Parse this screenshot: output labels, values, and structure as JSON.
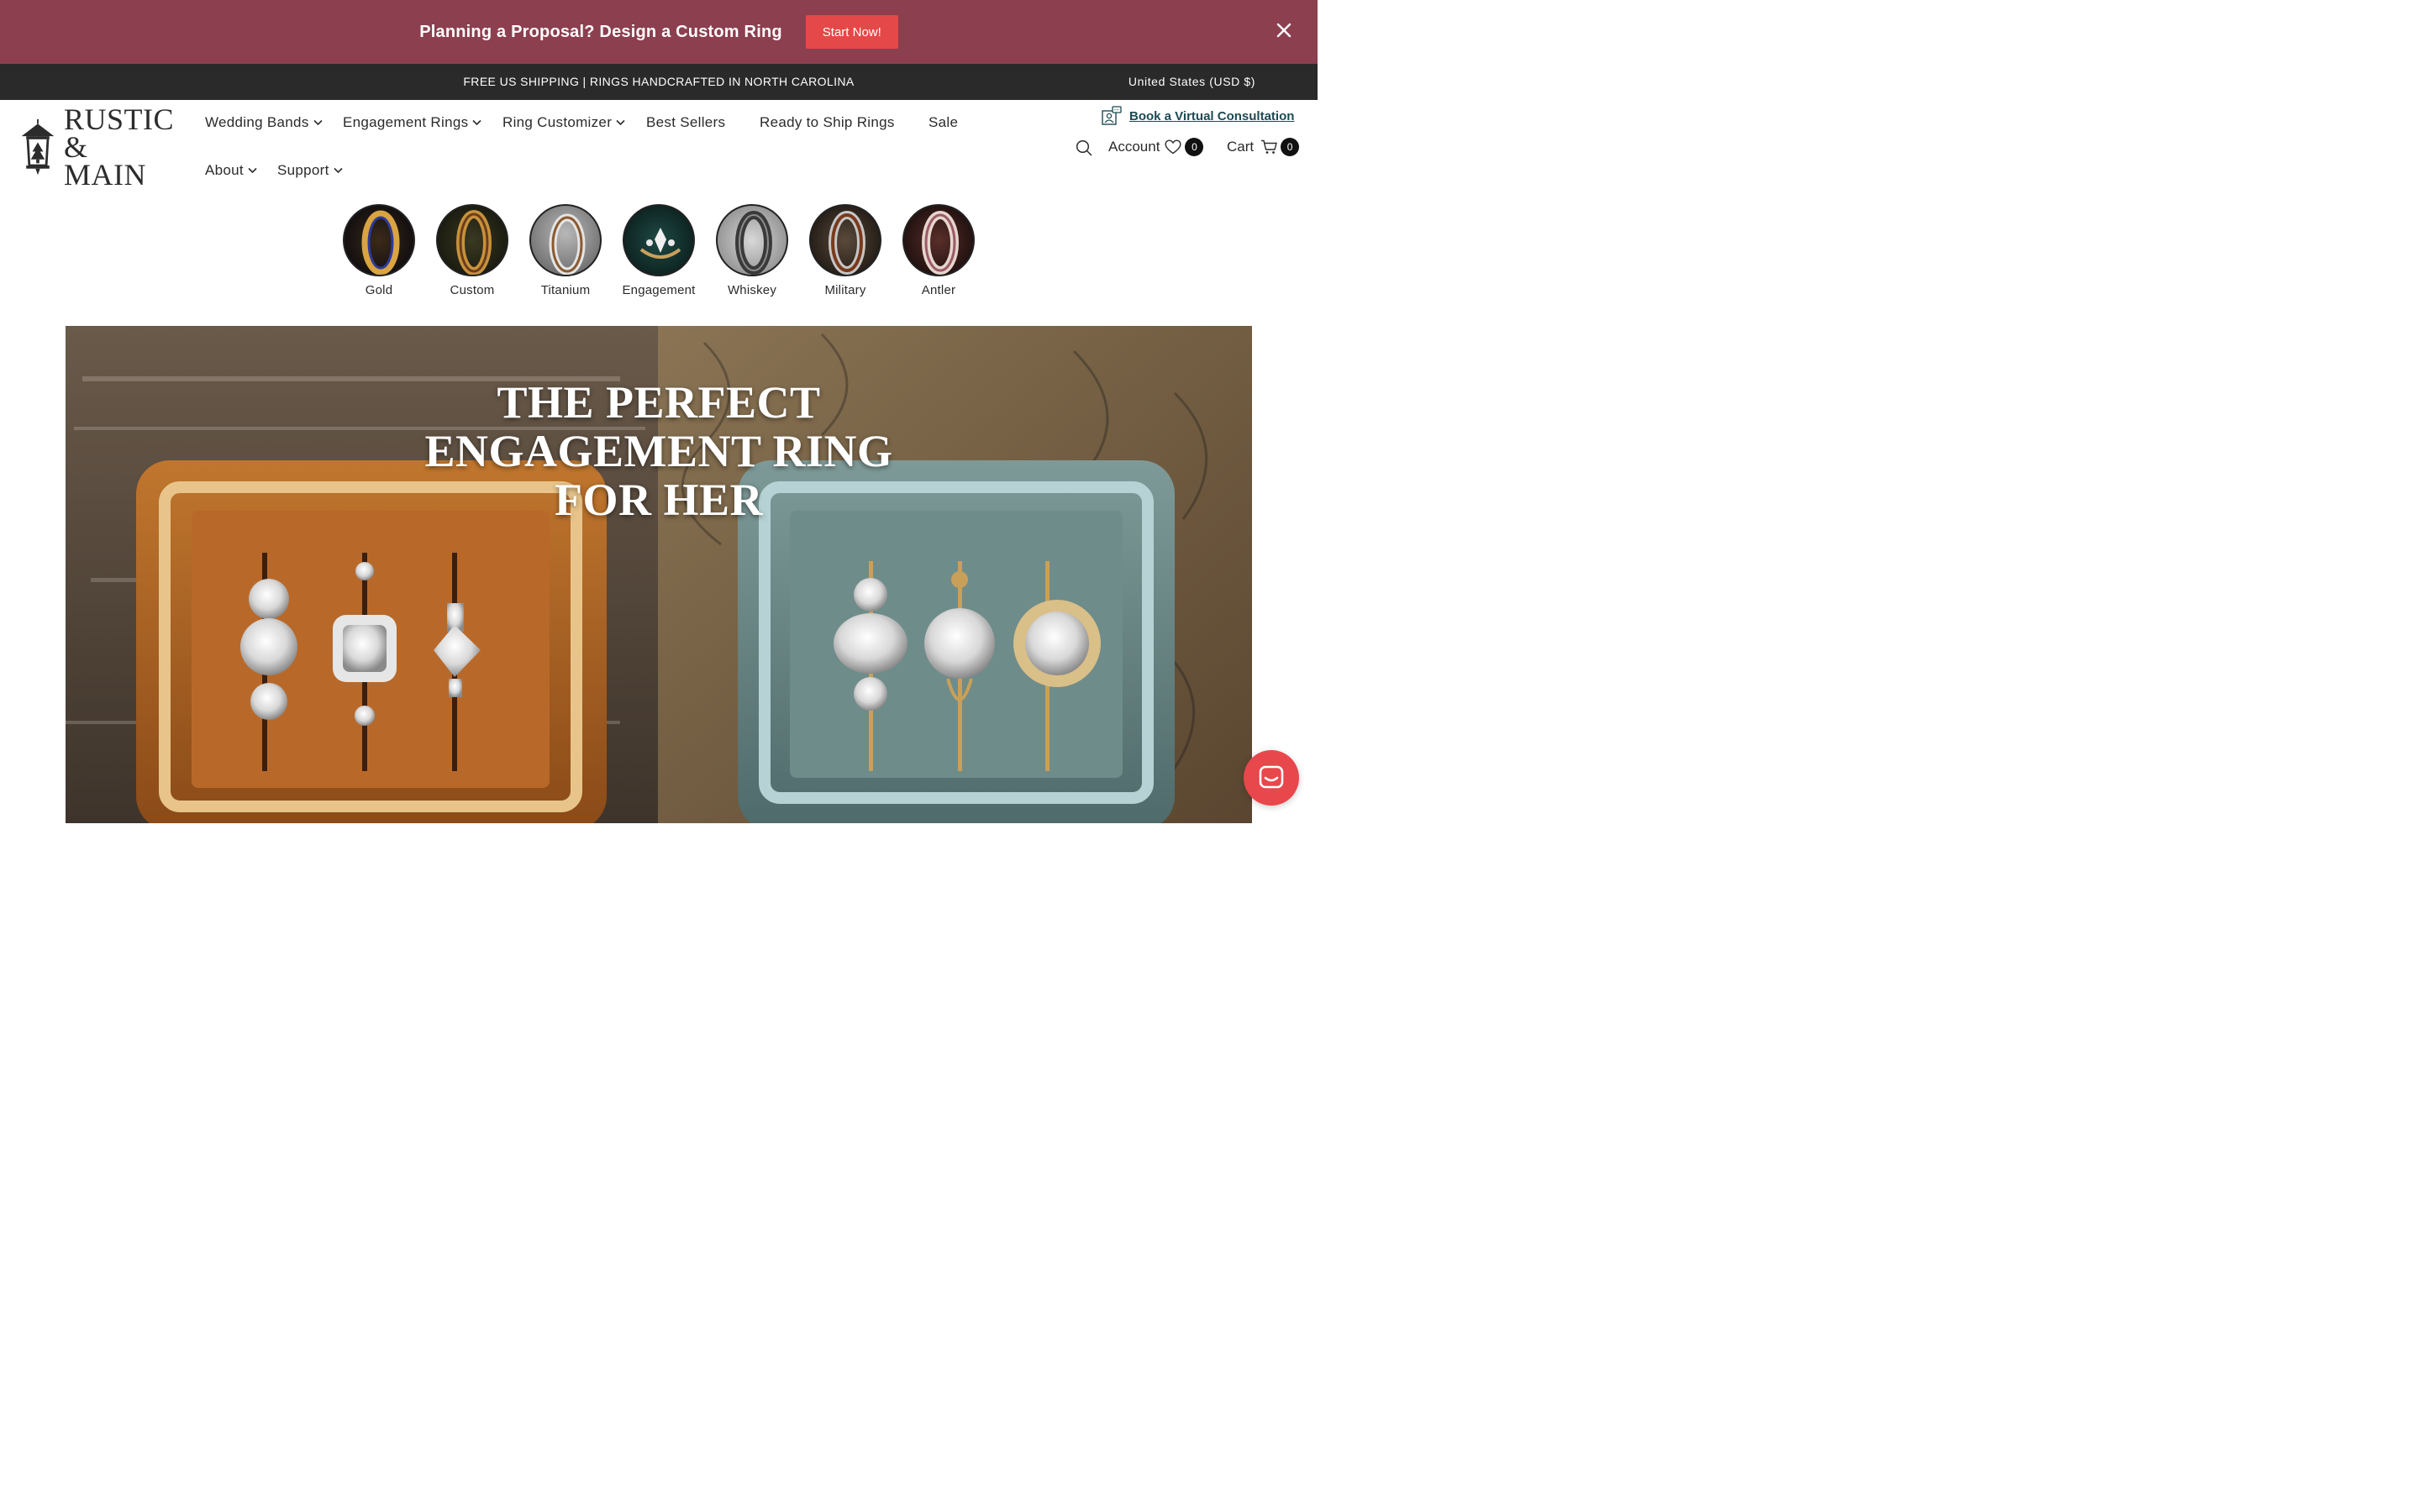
{
  "promo": {
    "text": "Planning a Proposal? Design a Custom Ring",
    "cta": "Start Now!",
    "bg_color": "#8c3f4f",
    "cta_color": "#e54848"
  },
  "shipbar": {
    "text": "FREE US SHIPPING | RINGS HANDCRAFTED IN NORTH CAROLINA",
    "currency": "United States (USD $)"
  },
  "logo": {
    "line1": "RUSTIC",
    "line2": "& MAIN"
  },
  "nav": {
    "wedding_bands": "Wedding Bands",
    "engagement_rings": "Engagement Rings",
    "ring_customizer": "Ring Customizer",
    "best_sellers": "Best Sellers",
    "ready_to_ship": "Ready to Ship Rings",
    "sale": "Sale",
    "about": "About",
    "support": "Support"
  },
  "header": {
    "consultation": "Book a Virtual Consultation",
    "account": "Account",
    "wishlist_count": "0",
    "cart": "Cart",
    "cart_count": "0"
  },
  "categories": [
    {
      "label": "Gold"
    },
    {
      "label": "Custom"
    },
    {
      "label": "Titanium"
    },
    {
      "label": "Engagement"
    },
    {
      "label": "Whiskey"
    },
    {
      "label": "Military"
    },
    {
      "label": "Antler"
    }
  ],
  "hero": {
    "line1": "THE PERFECT",
    "line2": "ENGAGEMENT RING",
    "line3": "FOR HER"
  },
  "colors": {
    "shipbar_bg": "#2a2a2a",
    "consult_link": "#1e4a52",
    "chat_bubble": "#e8474c"
  }
}
